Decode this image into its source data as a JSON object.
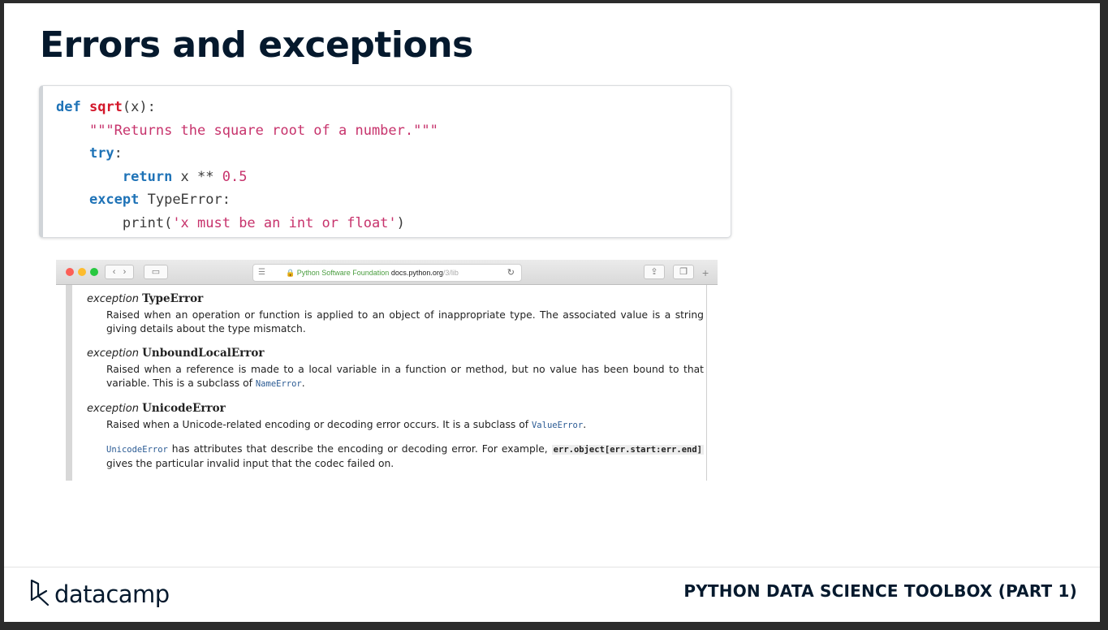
{
  "slide": {
    "title": "Errors and exceptions"
  },
  "code": {
    "l1": {
      "kw": "def",
      "fn": "sqrt",
      "rest": "(x):"
    },
    "l2": {
      "str": "\"\"\"Returns the square root of a number.\"\"\""
    },
    "l3": {
      "kw": "try",
      "rest": ":"
    },
    "l4": {
      "kw": "return",
      "rest": " x ** ",
      "num": "0.5"
    },
    "l5": {
      "kw": "except",
      "rest": " TypeError:"
    },
    "l6": {
      "pre": "print(",
      "str": "'x must be an int or float'",
      "post": ")"
    }
  },
  "browser": {
    "url_org": "Python Software Foundation",
    "url_domain": "docs.python.org",
    "url_path": "/3/lib"
  },
  "docs": {
    "entries": [
      {
        "prefix": "exception",
        "name": "TypeError",
        "text": "Raised when an operation or function is applied to an object of inappropriate type. The associated value is a string giving details about the type mismatch."
      },
      {
        "prefix": "exception",
        "name": "UnboundLocalError",
        "text": "Raised when a reference is made to a local variable in a function or method, but no value has been bound to that variable. This is a subclass of",
        "link": "NameError",
        "end": "."
      },
      {
        "prefix": "exception",
        "name": "UnicodeError",
        "text": "Raised when a Unicode-related encoding or decoding error occurs. It is a subclass of",
        "link": "ValueError",
        "end": ".",
        "p2_link": "UnicodeError",
        "p2_text": " has attributes that describe the encoding or decoding error. For example,",
        "p2_code": "err.object[err.start:err.end]",
        "p2_end": " gives the particular invalid input that the codec failed on."
      }
    ]
  },
  "footer": {
    "logo": "datacamp",
    "course": "PYTHON DATA SCIENCE TOOLBOX (PART 1)"
  }
}
